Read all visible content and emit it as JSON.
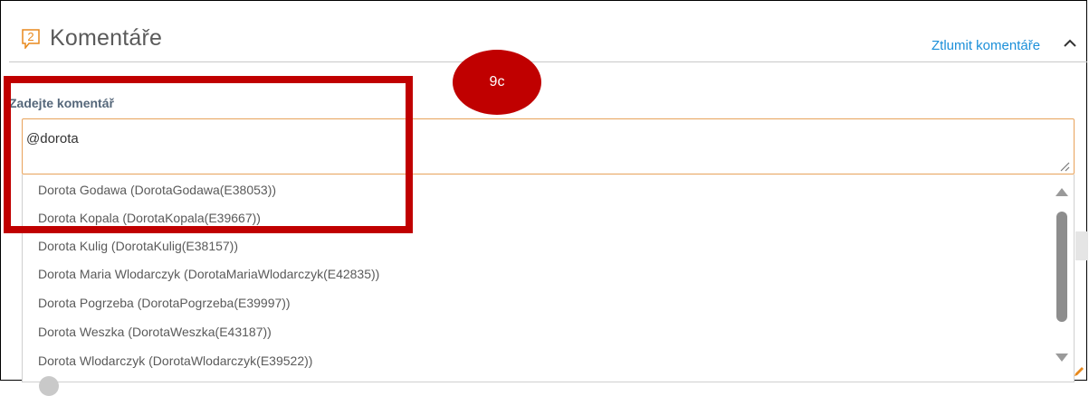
{
  "header": {
    "comment_count": "2",
    "title": "Komentáře",
    "mute_link": "Ztlumit komentáře"
  },
  "form": {
    "label": "Zadejte komentář",
    "input_value": "@dorota"
  },
  "suggestions": [
    "Dorota Godawa (DorotaGodawa(E38053))",
    "Dorota Kopala (DorotaKopala(E39667))",
    "Dorota Kulig (DorotaKulig(E38157))",
    "Dorota Maria Wlodarczyk (DorotaMariaWlodarczyk(E42835))",
    "Dorota Pogrzeba (DorotaPogrzeba(E39997))",
    "Dorota Weszka (DorotaWeszka(E43187))",
    "Dorota Wlodarczyk (DorotaWlodarczyk(E39522))"
  ],
  "annotation": {
    "badge_label": "9c"
  },
  "colors": {
    "accent_orange": "#e8891d",
    "link_blue": "#1b8fd9",
    "annotation_red": "#c00000"
  },
  "icons": [
    "comment-count-icon",
    "chevron-up-icon",
    "resize-grip-icon",
    "scroll-up-icon",
    "scroll-down-icon",
    "pencil-icon"
  ]
}
